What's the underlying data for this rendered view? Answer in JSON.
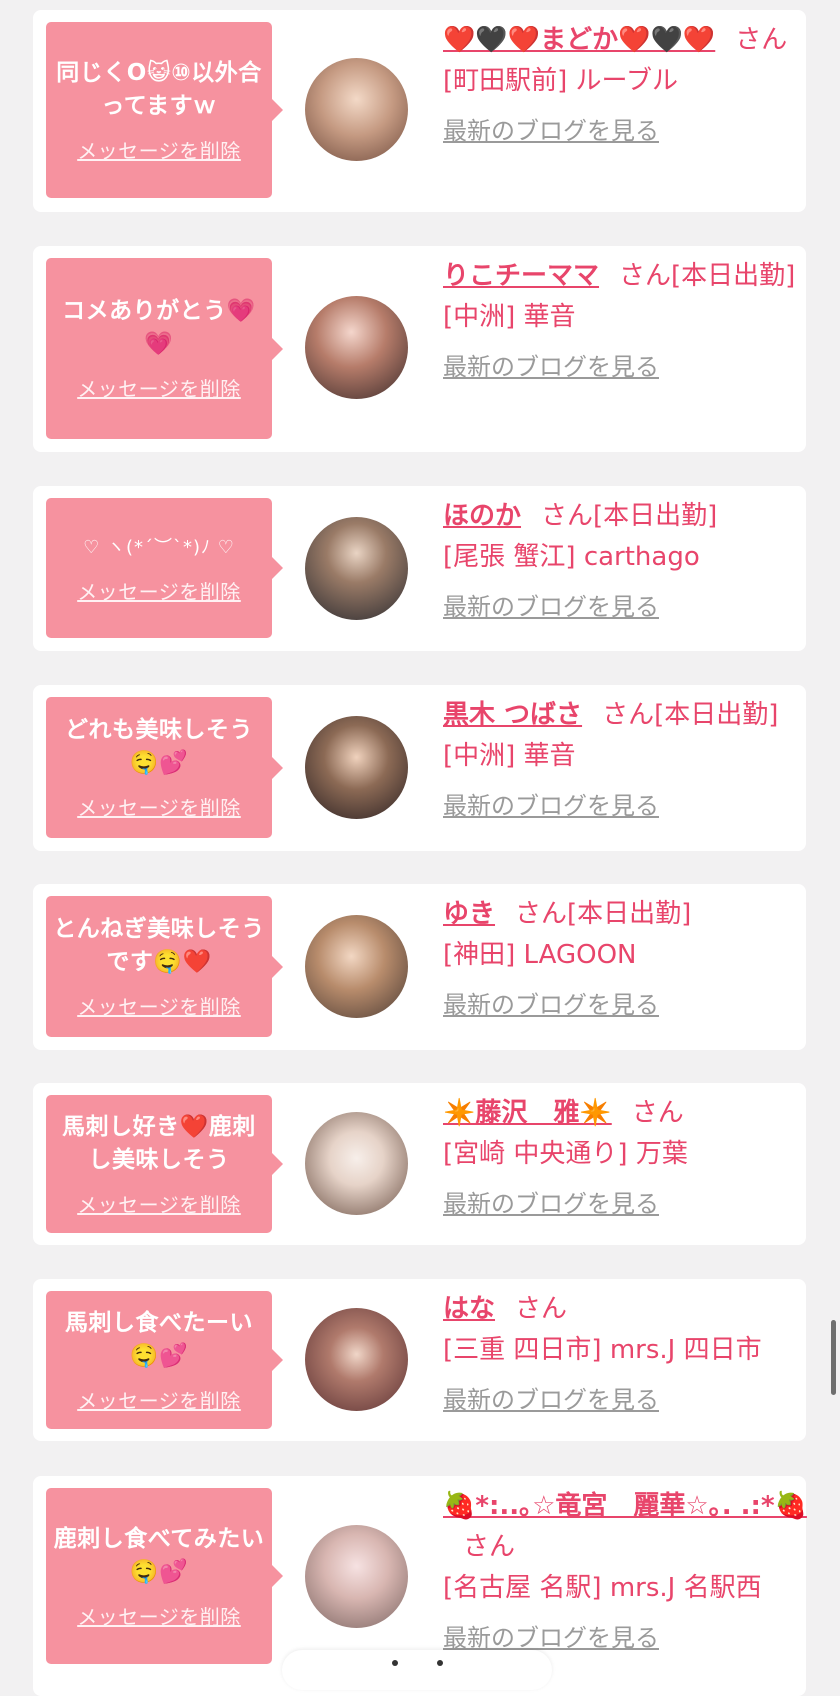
{
  "items": [
    {
      "message": "同じくO😺⑩以外合ってますｗ",
      "delete_label": "メッセージを削除",
      "name": "❤️🖤❤️まどか❤️🖤❤️",
      "san": "さん",
      "status": "",
      "shop": "[町田駅前] ルーブル",
      "blog": "最新のブログを見る"
    },
    {
      "message": "コメありがとう💗💗",
      "delete_label": "メッセージを削除",
      "name": "りこチーママ",
      "san": "さん",
      "status": "[本日出勤]",
      "shop": "[中洲] 華音",
      "blog": "最新のブログを見る"
    },
    {
      "message": "♡ ヽ(*´︶`*)ﾉ ♡",
      "delete_label": "メッセージを削除",
      "name": "ほのか",
      "san": "さん",
      "status": "[本日出勤]",
      "shop": "[尾張 蟹江] carthago",
      "blog": "最新のブログを見る"
    },
    {
      "message": "どれも美味しそう🤤💕",
      "delete_label": "メッセージを削除",
      "name": "黒木 つばさ",
      "san": "さん",
      "status": "[本日出勤]",
      "shop": "[中洲] 華音",
      "blog": "最新のブログを見る"
    },
    {
      "message": "とんねぎ美味しそうです🤤❤️",
      "delete_label": "メッセージを削除",
      "name": "ゆき",
      "san": "さん",
      "status": "[本日出勤]",
      "shop": "[神田] LAGOON",
      "blog": "最新のブログを見る"
    },
    {
      "message": "馬刺し好き❤️鹿刺し美味しそう",
      "delete_label": "メッセージを削除",
      "name": "✴️藤沢　雅✴️",
      "san": "さん",
      "status": "",
      "shop": "[宮崎 中央通り] 万葉",
      "blog": "最新のブログを見る"
    },
    {
      "message": "馬刺し食べたーい🤤💕",
      "delete_label": "メッセージを削除",
      "name": "はな",
      "san": "さん",
      "status": "",
      "shop": "[三重 四日市] mrs.J 四日市",
      "blog": "最新のブログを見る"
    },
    {
      "message": "鹿刺し食べてみたい🤤💕",
      "delete_label": "メッセージを削除",
      "name": "🍓*:..｡☆竜宮　麗華☆｡. .:*🍓",
      "san": "さん",
      "status": "",
      "shop": "[名古屋 名駅] mrs.J 名駅西",
      "blog": "最新のブログを見る"
    }
  ],
  "colors": {
    "accent": "#e8456b",
    "bubble": "#f6929f",
    "link_gray": "#9a9a9a",
    "background": "#f2f1f2"
  }
}
